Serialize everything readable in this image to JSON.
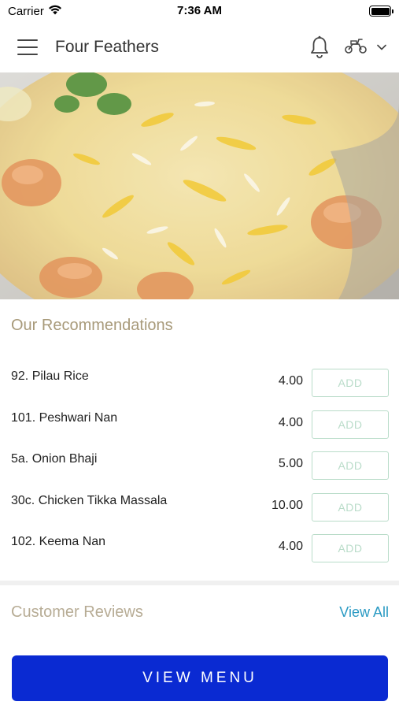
{
  "status_bar": {
    "carrier": "Carrier",
    "time": "7:36 AM"
  },
  "header": {
    "title": "Four Feathers",
    "menu_icon": "hamburger-menu-icon",
    "notification_icon": "bell-icon",
    "delivery_icon": "scooter-icon",
    "dropdown_icon": "chevron-down-icon"
  },
  "hero": {
    "image": "food-photo-biryani-rice-prawns"
  },
  "recommendations": {
    "title": "Our Recommendations",
    "items": [
      {
        "name": "92. Pilau Rice",
        "price": "4.00",
        "action": "ADD"
      },
      {
        "name": "101. Peshwari Nan",
        "price": "4.00",
        "action": "ADD"
      },
      {
        "name": "5a. Onion Bhaji",
        "price": "5.00",
        "action": "ADD"
      },
      {
        "name": "30c. Chicken Tikka Massala",
        "price": "10.00",
        "action": "ADD"
      },
      {
        "name": "102. Keema Nan",
        "price": "4.00",
        "action": "ADD"
      }
    ]
  },
  "reviews": {
    "title": "Customer Reviews",
    "view_all": "View All"
  },
  "footer": {
    "view_menu": "VIEW MENU"
  },
  "colors": {
    "primary_button": "#0a2ad2",
    "section_title": "#a89a7a",
    "add_button_border": "#b9dcc9",
    "link": "#2a9ac3"
  }
}
